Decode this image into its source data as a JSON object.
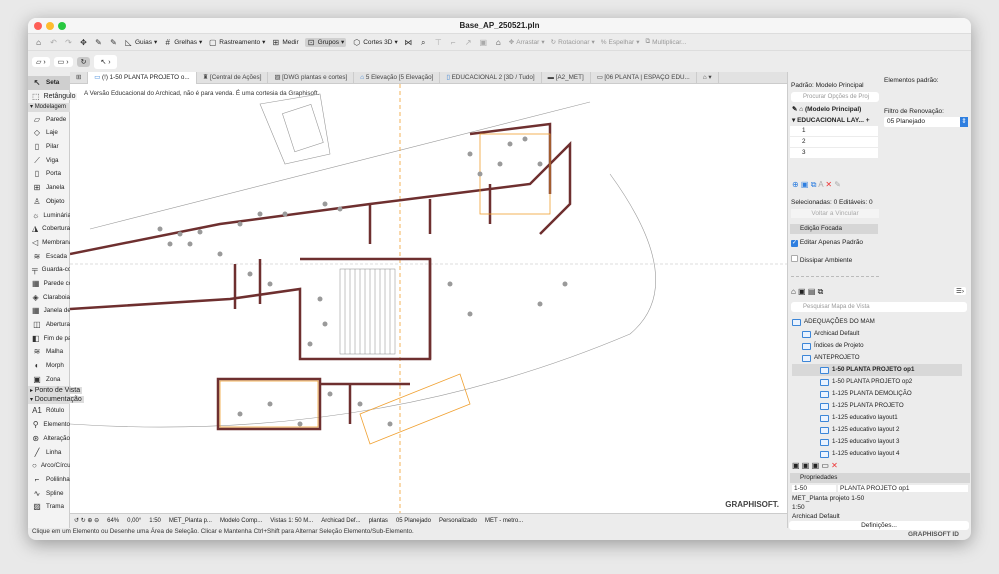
{
  "window": {
    "title": "Base_AP_250521.pln"
  },
  "toolbar": {
    "items": [
      {
        "label": "Guias",
        "icon": "guides-icon"
      },
      {
        "label": "Grelhas",
        "icon": "grid-icon"
      },
      {
        "label": "Rastreamento",
        "icon": "tracking-icon"
      },
      {
        "label": "Medir",
        "icon": "measure-icon"
      },
      {
        "label": "Grupos",
        "icon": "groups-icon"
      },
      {
        "label": "Cortes 3D",
        "icon": "3d-cut-icon"
      }
    ],
    "edit_items": [
      {
        "label": "Arrastar"
      },
      {
        "label": "Rotacionar"
      },
      {
        "label": "Espelhar"
      },
      {
        "label": "Multiplicar..."
      }
    ]
  },
  "tabs": [
    {
      "label": "(!) 1-50 PLANTA PROJETO o..."
    },
    {
      "label": "[Central de Ações]"
    },
    {
      "label": "[DWG plantas e cortes]"
    },
    {
      "label": "5 Elevação [5 Elevação]"
    },
    {
      "label": "EDUCACIONAL 2 [3D / Tudo]"
    },
    {
      "label": "[A2_MET]"
    },
    {
      "label": "[06 PLANTA  |  ESPAÇO EDU..."
    }
  ],
  "toolbox": {
    "top": [
      {
        "label": "Seta"
      },
      {
        "label": "Retângulo"
      }
    ],
    "group1": "Modelagem",
    "modeling": [
      {
        "label": "Parede"
      },
      {
        "label": "Laje"
      },
      {
        "label": "Pilar"
      },
      {
        "label": "Viga"
      },
      {
        "label": "Porta"
      },
      {
        "label": "Janela"
      },
      {
        "label": "Objeto"
      },
      {
        "label": "Luminária"
      },
      {
        "label": "Cobertura"
      },
      {
        "label": "Membrana"
      },
      {
        "label": "Escada"
      },
      {
        "label": "Guarda-corpo"
      },
      {
        "label": "Parede cortina"
      },
      {
        "label": "Claraboia"
      },
      {
        "label": "Janela de canto"
      },
      {
        "label": "Abertura"
      },
      {
        "label": "Fim de parede"
      },
      {
        "label": "Malha"
      },
      {
        "label": "Morph"
      },
      {
        "label": "Zona"
      }
    ],
    "group2": "Ponto de Vista",
    "group3": "Documentação",
    "documentation": [
      {
        "label": "Rótulo"
      },
      {
        "label": "Elemento"
      },
      {
        "label": "Alteração"
      },
      {
        "label": "Linha"
      },
      {
        "label": "Arco/Círculo"
      },
      {
        "label": "Polilinha"
      },
      {
        "label": "Spline"
      },
      {
        "label": "Trama"
      }
    ]
  },
  "canvas": {
    "notice": "A Versão Educacional do Archicad, não é para venda. É uma cortesia da Graphisoft.",
    "watermark": "GRAPHISOFT."
  },
  "statusbar": {
    "zoom": "64%",
    "angle": "0,00°",
    "scale": "1:50",
    "layer_combo": "MET_Planta p...",
    "model_view": "Modelo Comp...",
    "graphic": "Vistas 1: 50 M...",
    "dimension": "Archicad Def...",
    "pen_set": "plantas",
    "renovation": "05 Planejado",
    "custom": "Personalizado",
    "structure": "MET - metro..."
  },
  "message": "Clique em um Elemento ou Desenhe uma Área de Seleção. Clicar e Mantenha Ctrl+Shift para Alternar Seleção Elemento/Sub-Elemento.",
  "right": {
    "default_label": "Padrão: Modelo Principal",
    "elements_label": "Elementos padrão:",
    "search_placeholder": "Procurar Opções de Proj",
    "main_model": "(Modelo Principal)",
    "layout_header": "EDUCACIONAL LAY...",
    "layers": [
      "1",
      "2",
      "3"
    ],
    "renovation_label": "Filtro de Renovação:",
    "renovation_value": "05 Planejado",
    "selected_info": "Selecionadas: 0 Editáveis: 0",
    "relink": "Voltar a Vincular",
    "focused": "Edição Focada",
    "edit_default": "Editar Apenas Padrão",
    "edit_default_checked": true,
    "dissipate": "Dissipar Ambiente",
    "dissipate_checked": false,
    "view_search": "Pesquisar Mapa de Vista",
    "tree": [
      {
        "label": "ADEQUAÇÕES DO MAM",
        "level": 0
      },
      {
        "label": "Archicad Default",
        "level": 1
      },
      {
        "label": "Índices de Projeto",
        "level": 1
      },
      {
        "label": "ANTEPROJETO",
        "level": 1
      },
      {
        "label": "1-50 PLANTA PROJETO op1",
        "level": 2,
        "selected": true
      },
      {
        "label": "1-50 PLANTA PROJETO op2",
        "level": 2
      },
      {
        "label": "1-125 PLANTA DEMOLIÇÃO",
        "level": 2
      },
      {
        "label": "1-125 PLANTA PROJETO",
        "level": 2
      },
      {
        "label": "1-125 educativo layout1",
        "level": 2
      },
      {
        "label": "1-125 educativo layout 2",
        "level": 2
      },
      {
        "label": "1-125 educativo layout 3",
        "level": 2
      },
      {
        "label": "1-125 educativo layout 4",
        "level": 2
      }
    ],
    "properties": "Propriedades",
    "prop_id": "1-50",
    "prop_name": "PLANTA PROJETO op1",
    "prop_layers": "MET_Planta projeto 1-50",
    "prop_scale": "1:50",
    "prop_dim": "Archicad Default",
    "settings": "Definições...",
    "brand": "GRAPHISOFT ID"
  },
  "colors": {
    "wall": "#6e2f2f",
    "accent": "#f0a030",
    "selection": "#2f7fe0"
  }
}
